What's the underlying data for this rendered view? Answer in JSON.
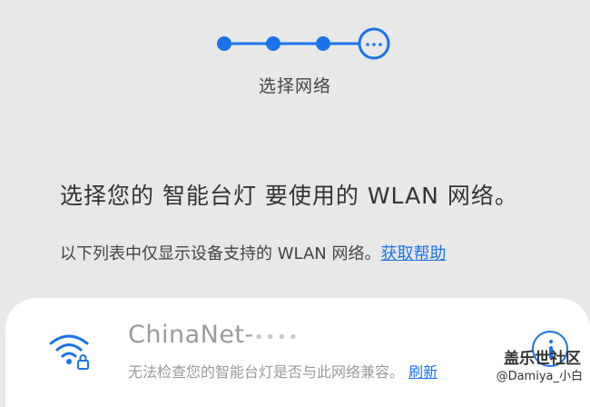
{
  "setup": {
    "steps_total": 4,
    "current_step": 4,
    "step_label": "选择网络"
  },
  "heading": "选择您的 智能台灯 要使用的 WLAN 网络。",
  "subtext": "以下列表中仅显示设备支持的 WLAN 网络。",
  "help_link": "获取帮助",
  "network": {
    "ssid": "ChinaNet-",
    "ssid_masked": "••••",
    "status": "无法检查您的智能台灯是否与此网络兼容。",
    "refresh_label": "刷新",
    "icon": "wifi-lock-icon"
  },
  "watermark": {
    "brand": "盖乐世社区",
    "user": "@Damiya_小白"
  },
  "colors": {
    "accent": "#1a73e8",
    "background": "#e8e8e8",
    "card": "#ffffff"
  }
}
